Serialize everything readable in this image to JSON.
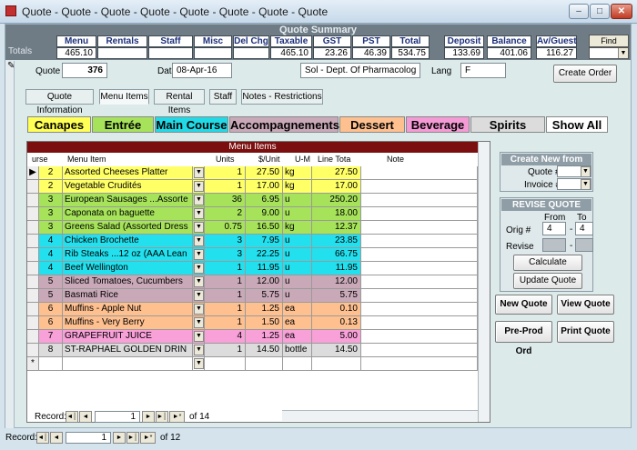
{
  "window": {
    "title": "Quote - Quote - Quote - Quote - Quote - Quote - Quote - Quote",
    "min": "–",
    "max": "□",
    "close": "✕"
  },
  "summary": {
    "title": "Quote Summary",
    "totals_label": "Totals",
    "headers": [
      "Menu",
      "Rentals",
      "Staff",
      "Misc Chg",
      "Del Chg",
      "Taxable",
      "GST",
      "PST",
      "Total",
      "Deposit",
      "Balance",
      "Av/Guest"
    ],
    "values": [
      "465.10",
      "",
      "",
      "",
      "",
      "465.10",
      "23.26",
      "46.39",
      "534.75",
      "133.69",
      "401.06",
      "116.27"
    ],
    "find_quote": "Find Quote"
  },
  "quote": {
    "quote_no_label": "Quote #",
    "quote_no": "376",
    "date_label": "Date",
    "date": "08-Apr-16",
    "client": "Sol - Dept. Of Pharmacolog",
    "lang_label": "Lang",
    "lang": "F",
    "create_order": "Create Order"
  },
  "tabs": [
    "Quote Information",
    "Menu Items",
    "Rental Items",
    "Staff",
    "Notes - Restrictions"
  ],
  "categories": [
    {
      "label": "Canapes",
      "color": "#ffff55"
    },
    {
      "label": "Entrée",
      "color": "#a6e35a"
    },
    {
      "label": "Main Course",
      "color": "#22d9e6"
    },
    {
      "label": "Accompagnements",
      "color": "#c9a9b8"
    },
    {
      "label": "Dessert",
      "color": "#ffc090"
    },
    {
      "label": "Beverage",
      "color": "#f49bd6"
    },
    {
      "label": "Spirits",
      "color": "#dcdcdc"
    },
    {
      "label": "Show All",
      "color": "#ffffff"
    }
  ],
  "grid": {
    "title": "Menu Items",
    "headers": [
      "urse",
      "Menu Item",
      "Units",
      "$/Unit",
      "U-M",
      "Line Tota",
      "Note"
    ],
    "rows": [
      {
        "course": "2",
        "item": "Assorted Cheeses Platter",
        "units": "1",
        "unit_price": "27.50",
        "um": "kg",
        "total": "27.50",
        "color": "#ffff66"
      },
      {
        "course": "2",
        "item": "Vegetable Crudités",
        "units": "1",
        "unit_price": "17.00",
        "um": "kg",
        "total": "17.00",
        "color": "#ffff66"
      },
      {
        "course": "3",
        "item": "European Sausages ...Assorte",
        "units": "36",
        "unit_price": "6.95",
        "um": "u",
        "total": "250.20",
        "color": "#a6e35a"
      },
      {
        "course": "3",
        "item": "Caponata on baguette",
        "units": "2",
        "unit_price": "9.00",
        "um": "u",
        "total": "18.00",
        "color": "#a6e35a"
      },
      {
        "course": "3",
        "item": "Greens Salad (Assorted Dress",
        "units": "0.75",
        "unit_price": "16.50",
        "um": "kg",
        "total": "12.37",
        "color": "#a6e35a"
      },
      {
        "course": "4",
        "item": "Chicken Brochette",
        "units": "3",
        "unit_price": "7.95",
        "um": "u",
        "total": "23.85",
        "color": "#22e0ee"
      },
      {
        "course": "4",
        "item": "Rib Steaks ...12 oz (AAA Lean",
        "units": "3",
        "unit_price": "22.25",
        "um": "u",
        "total": "66.75",
        "color": "#22e0ee"
      },
      {
        "course": "4",
        "item": "Beef Wellington",
        "units": "1",
        "unit_price": "11.95",
        "um": "u",
        "total": "11.95",
        "color": "#22e0ee"
      },
      {
        "course": "5",
        "item": "Sliced Tomatoes, Cucumbers",
        "units": "1",
        "unit_price": "12.00",
        "um": "u",
        "total": "12.00",
        "color": "#c9a9b8"
      },
      {
        "course": "5",
        "item": "Basmati Rice",
        "units": "1",
        "unit_price": "5.75",
        "um": "u",
        "total": "5.75",
        "color": "#c9a9b8"
      },
      {
        "course": "6",
        "item": "Muffins - Apple Nut",
        "units": "1",
        "unit_price": "1.25",
        "um": "ea",
        "total": "0.10",
        "color": "#ffc090"
      },
      {
        "course": "6",
        "item": "Muffins - Very Berry",
        "units": "1",
        "unit_price": "1.50",
        "um": "ea",
        "total": "0.13",
        "color": "#ffc090"
      },
      {
        "course": "7",
        "item": "GRAPEFRUIT JUICE",
        "units": "4",
        "unit_price": "1.25",
        "um": "ea",
        "total": "5.00",
        "color": "#f8a0d8"
      },
      {
        "course": "8",
        "item": "ST-RAPHAEL GOLDEN DRIN",
        "units": "1",
        "unit_price": "14.50",
        "um": "bottle",
        "total": "14.50",
        "color": "#dcdcdc"
      }
    ],
    "new_row_marker": "*",
    "current_marker": "▶",
    "record_label": "Record:",
    "record_current": "1",
    "record_of": "of 14"
  },
  "create_new": {
    "title": "Create New from",
    "quote_label": "Quote #",
    "invoice_label": "Invoice #"
  },
  "revise": {
    "title": "REVISE QUOTE",
    "from_label": "From",
    "to_label": "To",
    "orig_label": "Orig #",
    "orig_from": "4",
    "orig_to": "4",
    "revise_label": "Revise",
    "calculate": "Calculate",
    "update": "Update Quote"
  },
  "actions": {
    "new_quote": "New Quote",
    "view_quote": "View Quote",
    "pre_prod": "Pre-Prod Ord",
    "print_quote": "Print Quote"
  },
  "footer": {
    "record_label": "Record:",
    "record_current": "1",
    "record_of": "of 12"
  },
  "nav": {
    "first": "◄│",
    "prev": "◄",
    "next": "►",
    "last": "►│",
    "new": "►*"
  }
}
